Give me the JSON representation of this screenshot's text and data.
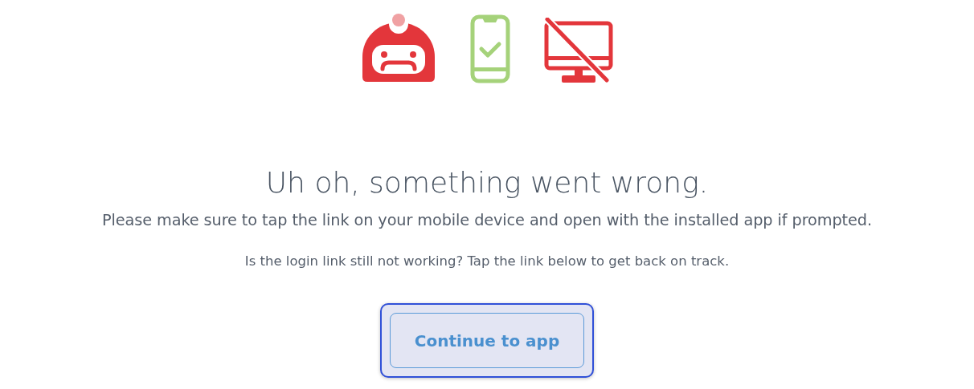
{
  "heading": "Uh oh, something went wrong.",
  "instructions": "Please make sure to tap the link on your mobile device and open with the installed app if prompted.",
  "hint": "Is the login link still not working? Tap the link below to get back on track.",
  "button": {
    "label": "Continue to app",
    "focused": true
  }
}
